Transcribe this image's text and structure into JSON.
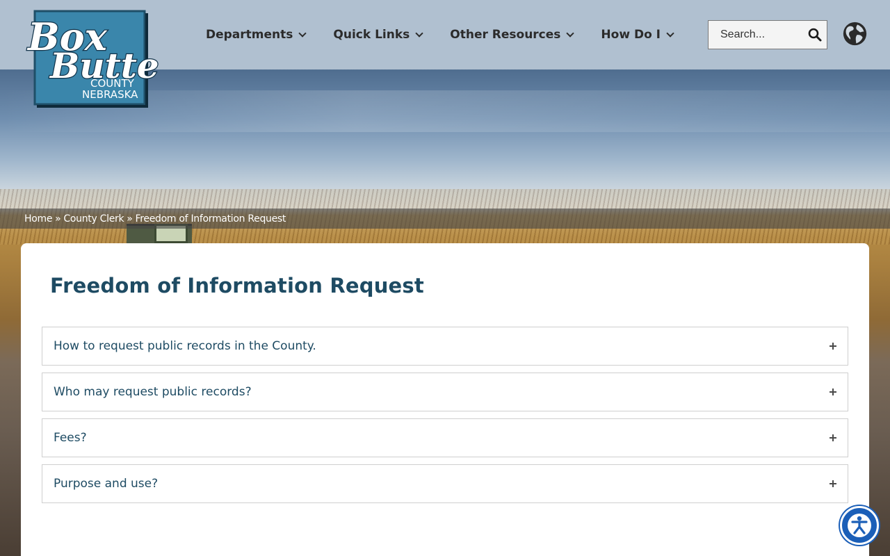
{
  "site": {
    "logo": {
      "script_line1": "Box",
      "script_line2": "Butte",
      "line3": "COUNTY",
      "line4": "NEBRASKA"
    }
  },
  "nav": {
    "items": [
      {
        "label": "Departments"
      },
      {
        "label": "Quick Links"
      },
      {
        "label": "Other Resources"
      },
      {
        "label": "How Do I"
      }
    ]
  },
  "search": {
    "placeholder": "Search..."
  },
  "breadcrumb": {
    "items": [
      "Home",
      "County Clerk",
      "Freedom of Information Request"
    ],
    "separator": "»"
  },
  "page": {
    "title": "Freedom of Information Request"
  },
  "accordion": {
    "items": [
      {
        "label": "How to request public records in the County."
      },
      {
        "label": "Who may request public records?"
      },
      {
        "label": "Fees?"
      },
      {
        "label": "Purpose and use?"
      }
    ]
  },
  "colors": {
    "title": "#1e4b63",
    "logo_blue": "#3a86ab",
    "accessibility_blue": "#1b5fb8"
  },
  "icons": [
    "search-icon",
    "globe-icon",
    "chevron-down-icon",
    "plus-icon",
    "accessibility-icon"
  ]
}
